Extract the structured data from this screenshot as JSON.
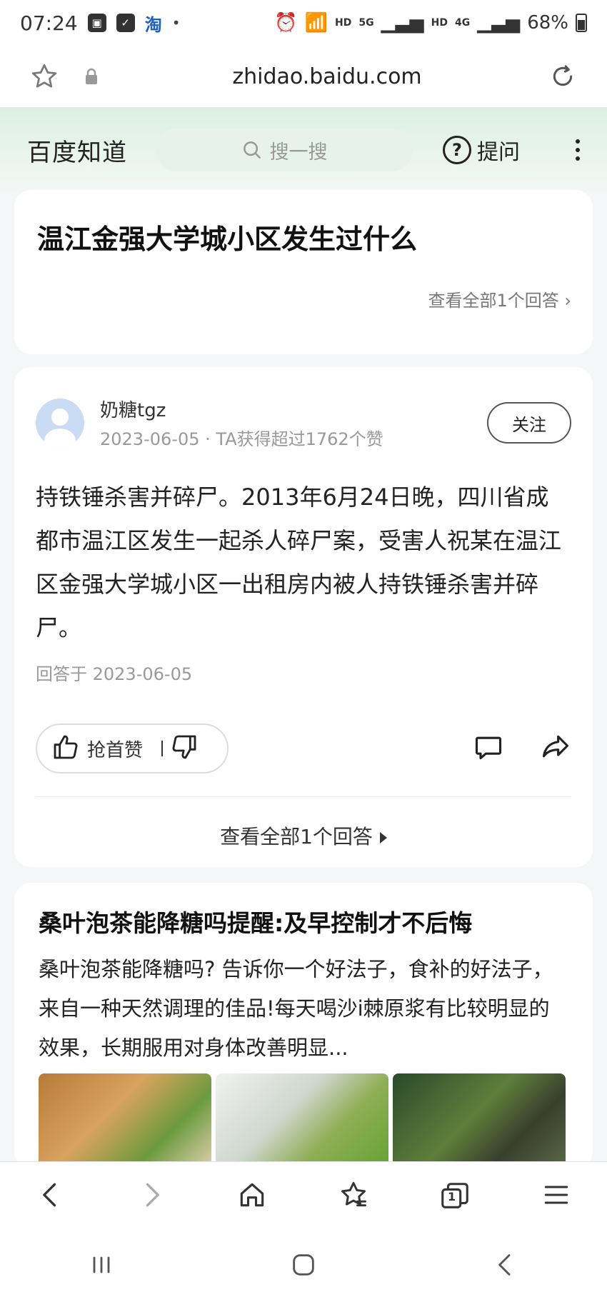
{
  "status_bar": {
    "time": "07:24",
    "app_badge": "淘",
    "dot": "•",
    "net_hd_1": "HD",
    "net_5g": "5G",
    "net_hd_2": "HD",
    "net_4g": "4G",
    "battery": "68%"
  },
  "browser": {
    "url": "zhidao.baidu.com"
  },
  "site_header": {
    "logo": "百度知道",
    "search_placeholder": "搜一搜",
    "ask_label": "提问"
  },
  "question": {
    "title": "温江金强大学城小区发生过什么",
    "all_answers_link": "查看全部1个回答"
  },
  "answer": {
    "author": "奶糖tgz",
    "date": "2023-06-05",
    "meta_sep": "·",
    "likes_note": "TA获得超过1762个赞",
    "follow_label": "关注",
    "body": "持铁锤杀害并碎尸。2013年6月24日晚，四川省成都市温江区发生一起杀人碎尸案，受害人祝某在温江区金强大学城小区一出租房内被人持铁锤杀害并碎尸。",
    "answered_at": "回答于 2023-06-05",
    "like_label": "抢首赞",
    "all_answers_link": "查看全部1个回答"
  },
  "ad": {
    "title": "桑叶泡茶能降糖吗提醒:及早控制才不后悔",
    "desc": "桑叶泡茶能降糖吗? 告诉你一个好法子，食补的好法子，来自一种天然调理的佳品!每天喝沙i棘原浆有比较明显的效果，长期服用对身体改善明显..."
  },
  "browser_nav": {
    "tabs_count": "1"
  },
  "colors": {
    "header_tint": "#dcefe3",
    "search_bg": "#e8f2ec"
  }
}
